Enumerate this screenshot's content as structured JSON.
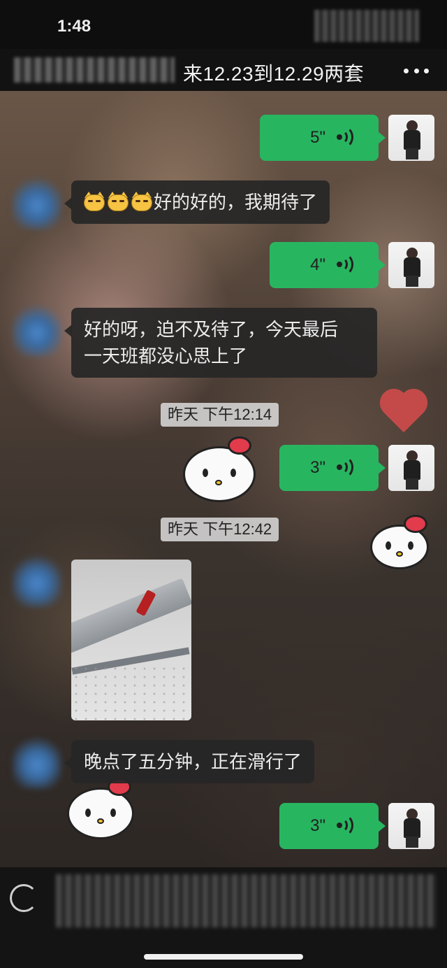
{
  "status_bar": {
    "time": "1:48"
  },
  "header": {
    "title": "来12.23到12.29两套",
    "more_icon": "more-dots-icon"
  },
  "messages": [
    {
      "type": "voice",
      "from": "me",
      "duration": "5\""
    },
    {
      "type": "text",
      "from": "other",
      "emoji": [
        "cat-emoji",
        "cat-emoji",
        "cat-emoji"
      ],
      "text": "好的好的，我期待了"
    },
    {
      "type": "voice",
      "from": "me",
      "duration": "4\""
    },
    {
      "type": "text",
      "from": "other",
      "lines": [
        "好的呀，迫不及待了，今天最后",
        "一天班都没心思上了"
      ]
    },
    {
      "type": "timestamp",
      "text": "昨天 下午12:14"
    },
    {
      "type": "voice",
      "from": "me",
      "duration": "3\""
    },
    {
      "type": "timestamp",
      "text": "昨天 下午12:42"
    },
    {
      "type": "image",
      "from": "other",
      "subject": "airplane wing in snow"
    },
    {
      "type": "text",
      "from": "other",
      "text": "晚点了五分钟，正在滑行了"
    },
    {
      "type": "voice",
      "from": "me",
      "duration": "3\""
    }
  ],
  "colors": {
    "voice_bubble": "#28b560",
    "text_bubble": "#262626",
    "header_bg": "#121212"
  }
}
